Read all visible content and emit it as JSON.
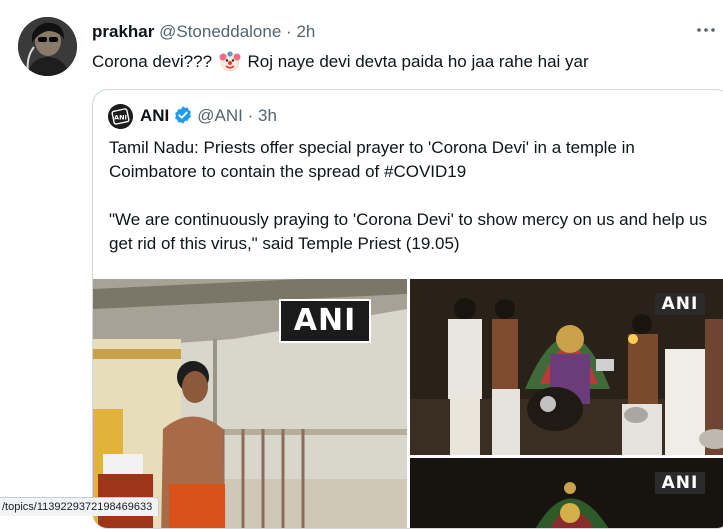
{
  "tweet": {
    "author_name": "prakhar",
    "author_handle": "@Stoneddalone",
    "separator": "·",
    "time": "2h",
    "text_before_emoji": "Corona devi???",
    "emoji": "clown-face",
    "text_after_emoji": "Roj naye devi devta paida ho jaa rahe hai yar"
  },
  "quoted_tweet": {
    "author_name": "ANI",
    "author_handle": "@ANI",
    "separator": "·",
    "time": "3h",
    "paragraph1": "Tamil Nadu: Priests offer special prayer to 'Corona Devi' in a temple in Coimbatore to contain the spread of #COVID19",
    "paragraph2": "\"We are continuously praying to 'Corona Devi' to show mercy on us and help us get rid of this virus,\" said Temple Priest (19.05)",
    "media": [
      {
        "watermark": "ANI"
      },
      {
        "watermark": "ANI"
      },
      {
        "watermark": "ANI"
      }
    ]
  },
  "status_bar": {
    "url": "/topics/1139229372198469633"
  },
  "icons": {
    "more": "more-horizontal-icon",
    "verified": "verified-badge-icon"
  },
  "colors": {
    "text": "#0f1419",
    "secondary": "#536471",
    "verified": "#1d9bf0",
    "border": "#cfd9de"
  }
}
